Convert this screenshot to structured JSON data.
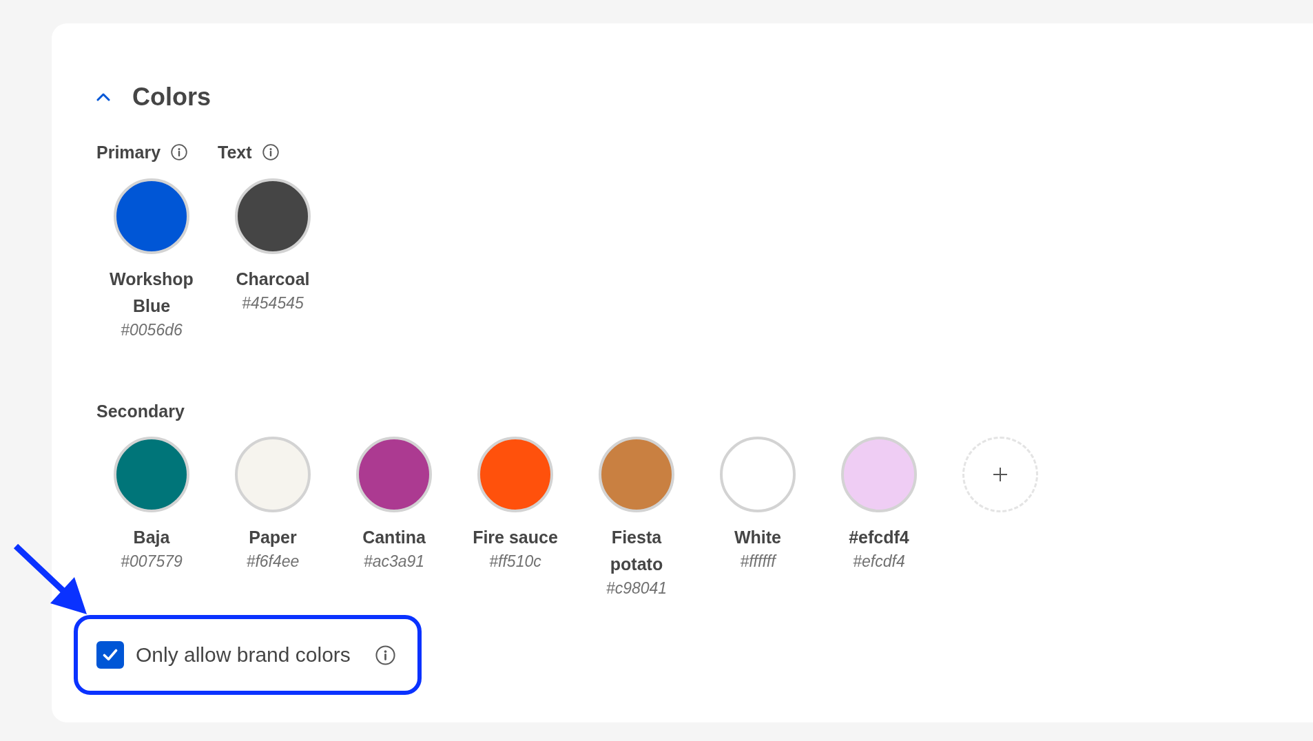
{
  "section": {
    "title": "Colors",
    "expanded": true,
    "primary_groups": [
      {
        "label": "Primary",
        "swatch": {
          "name": "Workshop Blue",
          "code": "#0056d6",
          "color": "#0056d6"
        }
      },
      {
        "label": "Text",
        "swatch": {
          "name": "Charcoal",
          "code": "#454545",
          "color": "#454545"
        }
      }
    ],
    "secondary": {
      "label": "Secondary",
      "swatches": [
        {
          "name": "Baja",
          "code": "#007579",
          "color": "#007579"
        },
        {
          "name": "Paper",
          "code": "#f6f4ee",
          "color": "#f6f4ee"
        },
        {
          "name": "Cantina",
          "code": "#ac3a91",
          "color": "#ac3a91"
        },
        {
          "name": "Fire sauce",
          "code": "#ff510c",
          "color": "#ff510c"
        },
        {
          "name": "Fiesta potato",
          "code": "#c98041",
          "color": "#c98041"
        },
        {
          "name": "White",
          "code": "#ffffff",
          "color": "#ffffff"
        },
        {
          "name": "#efcdf4",
          "code": "#efcdf4",
          "color": "#efcdf4"
        }
      ]
    },
    "brand_only": {
      "label": "Only allow brand colors",
      "checked": true,
      "highlighted": true
    }
  }
}
